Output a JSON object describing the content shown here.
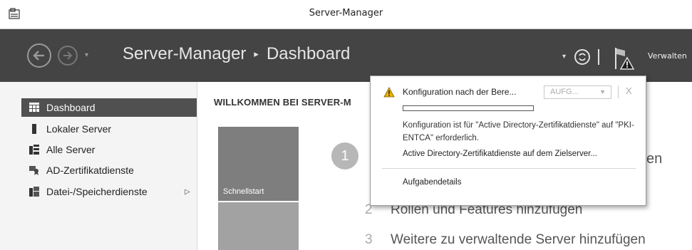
{
  "window": {
    "title": "Server-Manager"
  },
  "header": {
    "breadcrumb_root": "Server-Manager",
    "breadcrumb_sep": "▸",
    "breadcrumb_current": "Dashboard",
    "manage_label": "Verwalten",
    "accent_bg": "#444444"
  },
  "sidebar": {
    "items": [
      {
        "label": "Dashboard",
        "icon": "dashboard-icon",
        "active": true
      },
      {
        "label": "Lokaler Server",
        "icon": "server-icon"
      },
      {
        "label": "Alle Server",
        "icon": "servers-icon"
      },
      {
        "label": "AD-Zertifikatdienste",
        "icon": "certificate-icon"
      },
      {
        "label": "Datei-/Speicherdienste",
        "icon": "storage-icon",
        "has_submenu": true
      }
    ]
  },
  "main": {
    "welcome": "WILLKOMMEN BEI SERVER-M",
    "tile_quickstart": "Schnellstart",
    "step1_number": "1",
    "step1_tail": "en",
    "step2": {
      "num": "2",
      "label": "Rollen und Features hinzufügen"
    },
    "step3": {
      "num": "3",
      "label": "Weitere zu verwaltende Server hinzufügen"
    }
  },
  "notification": {
    "title": "Konfiguration nach der Bere...",
    "task_dropdown": "AUFG...",
    "close": "X",
    "progress_fraction": 0.0,
    "description": "Konfiguration ist für \"Active Directory-Zertifikatdienste\" auf \"PKI-ENTCA\" erforderlich.",
    "action_link": "Active Directory-Zertifikatdienste auf dem Zielserver...",
    "details_link": "Aufgabendetails",
    "warning_color": "#e8b100"
  }
}
